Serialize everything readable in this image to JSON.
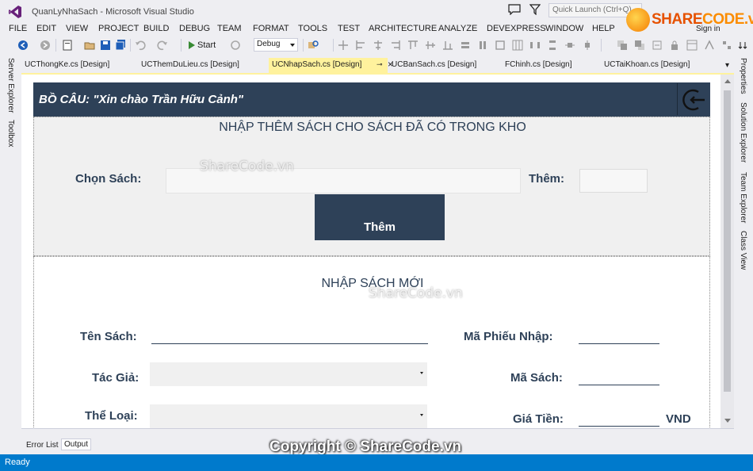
{
  "window": {
    "title": "QuanLyNhaSach - Microsoft Visual Studio",
    "quick_launch_placeholder": "Quick Launch (Ctrl+Q)",
    "sign_in": "Sign in"
  },
  "watermark_logo": {
    "prefix": "SHARE",
    "suffix": "CODE.vn"
  },
  "menu": [
    "FILE",
    "EDIT",
    "VIEW",
    "PROJECT",
    "BUILD",
    "DEBUG",
    "TEAM",
    "FORMAT",
    "TOOLS",
    "TEST",
    "ARCHITECTURE",
    "ANALYZE",
    "DEVEXPRESS",
    "WINDOW",
    "HELP"
  ],
  "toolbar": {
    "start_label": "Start",
    "configuration": "Debug"
  },
  "left_side_tabs": [
    "Server Explorer",
    "Toolbox"
  ],
  "right_side_tabs": [
    "Properties",
    "Solution Explorer",
    "Team Explorer",
    "Class View"
  ],
  "document_tabs": [
    {
      "label": "UCThongKe.cs [Design]"
    },
    {
      "label": "UCThemDuLieu.cs [Design]"
    },
    {
      "label": "UCNhapSach.cs [Design]",
      "active": true
    },
    {
      "label": "UCBanSach.cs [Design]"
    },
    {
      "label": "FChinh.cs [Design]"
    },
    {
      "label": "UCTaiKhoan.cs [Design]"
    }
  ],
  "form": {
    "greeting": "BỒ CÂU: \"Xin chào Trần Hữu Cảnh\"",
    "top_panel": {
      "title": "NHẬP THÊM SÁCH CHO SÁCH ĐÃ CÓ TRONG KHO",
      "choose_book_label": "Chọn Sách:",
      "add_qty_label": "Thêm:",
      "add_button": "Thêm"
    },
    "bottom_panel": {
      "title": "NHẬP SÁCH MỚI",
      "book_name_label": "Tên Sách:",
      "author_label": "Tác Giả:",
      "category_label": "Thể Loại:",
      "receipt_id_label": "Mã Phiếu Nhập:",
      "book_id_label": "Mã Sách:",
      "price_label": "Giá Tiền:",
      "currency": "VND"
    }
  },
  "watermark_text": "ShareCode.vn",
  "output_tabs": {
    "error_list": "Error List",
    "output": "Output"
  },
  "copyright": "Copyright © ShareCode.vn",
  "status": "Ready",
  "colors": {
    "accent": "#007ACC",
    "form_primary": "#2E4158",
    "active_tab": "#FFF29D"
  }
}
